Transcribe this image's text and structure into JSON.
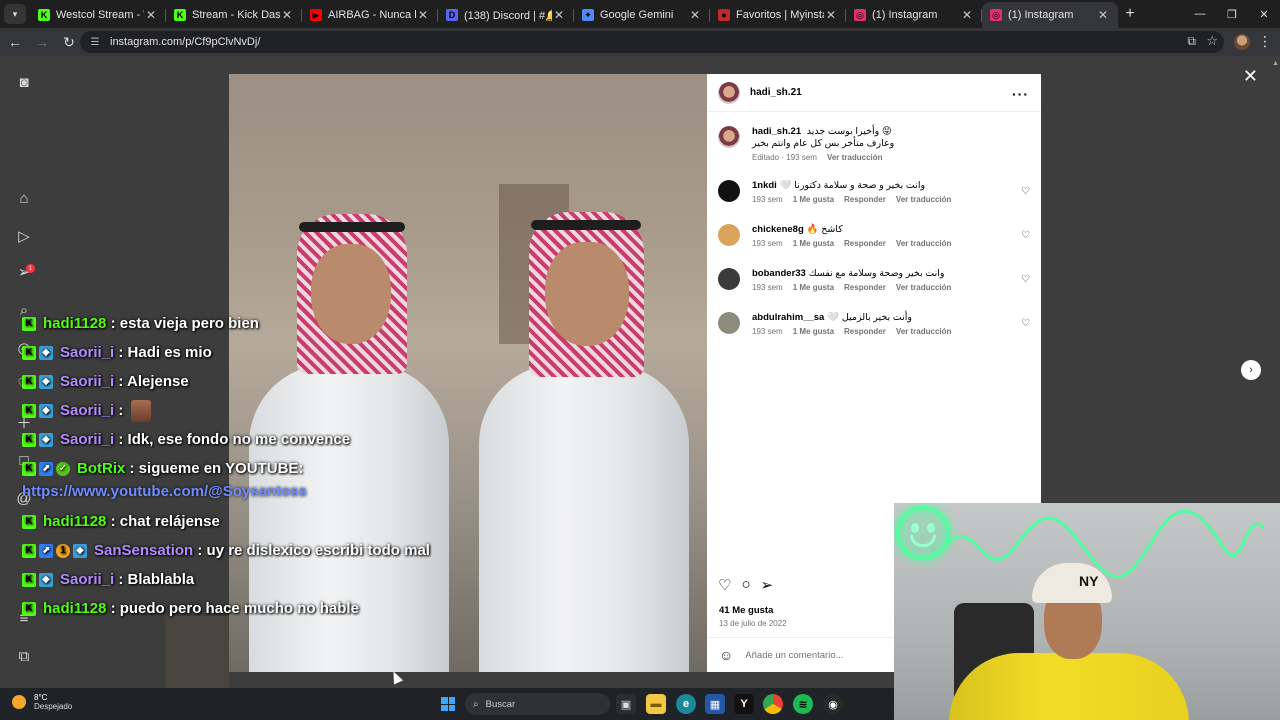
{
  "browser": {
    "tabs": [
      {
        "title": "Westcol Stream - Watch L",
        "favicon_color": "#53fc18",
        "favicon_glyph": "K",
        "active": false
      },
      {
        "title": "Stream - Kick Dashboard",
        "favicon_color": "#53fc18",
        "favicon_glyph": "K",
        "active": false
      },
      {
        "title": "AIRBAG - Nunca lo olvide",
        "favicon_color": "#ff0000",
        "favicon_glyph": "▶",
        "active": false
      },
      {
        "title": "(138) Discord | #🔔 | n",
        "favicon_color": "#5865f2",
        "favicon_glyph": "D",
        "active": false
      },
      {
        "title": "Google Gemini",
        "favicon_color": "#4f8bf5",
        "favicon_glyph": "✦",
        "active": false
      },
      {
        "title": "Favoritos | Myinstants",
        "favicon_color": "#c0282d",
        "favicon_glyph": "●",
        "active": false
      },
      {
        "title": "(1) Instagram",
        "favicon_color": "#e1306c",
        "favicon_glyph": "◎",
        "active": false
      },
      {
        "title": "(1) Instagram",
        "favicon_color": "#e1306c",
        "favicon_glyph": "◎",
        "active": true
      }
    ],
    "url": "instagram.com/p/Cf9pClvNvDj/"
  },
  "post": {
    "username": "hadi_sh.21",
    "caption": {
      "username": "hadi_sh.21",
      "line1": "وأخيرا بوست جديد 😝",
      "line2": "وعارف متأخر بس كل عام وانتم بخير",
      "meta_edited": "Editado · 193 sem",
      "meta_translate": "Ver traducción"
    },
    "comments": [
      {
        "username": "1nkdi",
        "text": "🤍 وانت بخير و صحة و سلامة دكتورنا",
        "time": "193 sem",
        "likes": "1 Me gusta",
        "reply": "Responder",
        "translate": "Ver traducción",
        "avatar_color": "#111111"
      },
      {
        "username": "chickene8g",
        "text": "🔥 كاشخ",
        "time": "193 sem",
        "likes": "1 Me gusta",
        "reply": "Responder",
        "translate": "Ver traducción",
        "avatar_color": "#d9a35a"
      },
      {
        "username": "bobander33",
        "text": "وانت بخير وصحة وسلامة مع نفسك",
        "time": "193 sem",
        "likes": "1 Me gusta",
        "reply": "Responder",
        "translate": "Ver traducción",
        "avatar_color": "#3b3b3b"
      },
      {
        "username": "abdulrahim__sa",
        "text": "🤍 وأنت بخير بالزميل",
        "time": "193 sem",
        "likes": "1 Me gusta",
        "reply": "Responder",
        "translate": "Ver traducción",
        "avatar_color": "#8c8c7c"
      }
    ],
    "likes": "41 Me gusta",
    "date": "13 de julio de 2022",
    "add_comment_placeholder": "Añade un comentario..."
  },
  "chat": [
    {
      "badges": [
        "kick"
      ],
      "user": "hadi1128",
      "user_color": "green",
      "message": ": esta vieja pero bien"
    },
    {
      "badges": [
        "kick",
        "sub"
      ],
      "user": "Saorii_i",
      "user_color": "purple",
      "message": ": Hadi es mio"
    },
    {
      "badges": [
        "kick",
        "sub"
      ],
      "user": "Saorii_i",
      "user_color": "purple",
      "message": ": Alejense"
    },
    {
      "badges": [
        "kick",
        "sub"
      ],
      "user": "Saorii_i",
      "user_color": "purple",
      "message": ":",
      "emote": true
    },
    {
      "badges": [
        "kick",
        "sub"
      ],
      "user": "Saorii_i",
      "user_color": "purple",
      "message": ": Idk, ese fondo no me convence"
    },
    {
      "badges": [
        "kick",
        "bot",
        "check"
      ],
      "user": "BotRix",
      "user_color": "green",
      "message": ": sigueme en YOUTUBE:"
    },
    {
      "link": "https://www.youtube.com/@Soysantoss"
    },
    {
      "badges": [
        "kick"
      ],
      "user": "hadi1128",
      "user_color": "green",
      "message": ": chat relájense"
    },
    {
      "badges": [
        "kick",
        "bot",
        "gift",
        "sub"
      ],
      "user": "SanSensation",
      "user_color": "purple",
      "message": ": uy re dislexico escribi todo mal"
    },
    {
      "badges": [
        "kick",
        "sub"
      ],
      "user": "Saorii_i",
      "user_color": "purple",
      "message": ": Blablabla"
    },
    {
      "badges": [
        "kick"
      ],
      "user": "hadi1128",
      "user_color": "green",
      "message": ": puedo pero hace mucho no hable"
    }
  ],
  "taskbar": {
    "weather_temp": "8°C",
    "weather_desc": "Despejado",
    "search_placeholder": "Buscar"
  },
  "colors": {
    "kick_green": "#53fc18",
    "instagram_badge": "#ff3040",
    "chat_purple": "#b38bff"
  }
}
